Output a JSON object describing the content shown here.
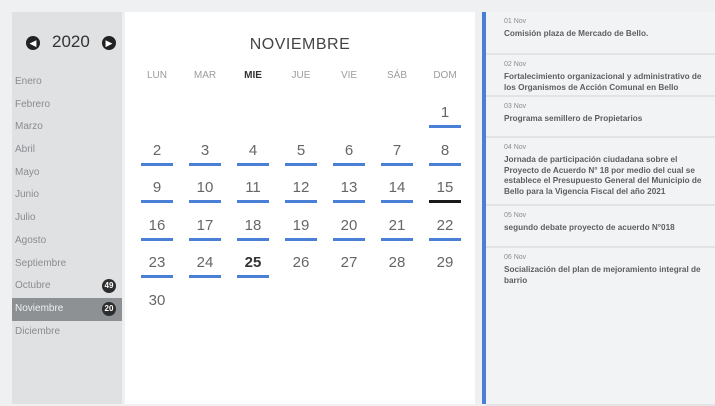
{
  "sidebar": {
    "year": "2020",
    "prev_icon": "chevron-left-icon",
    "next_icon": "chevron-right-icon",
    "months": [
      {
        "label": "Enero",
        "badge": ""
      },
      {
        "label": "Febrero",
        "badge": ""
      },
      {
        "label": "Marzo",
        "badge": ""
      },
      {
        "label": "Abril",
        "badge": ""
      },
      {
        "label": "Mayo",
        "badge": ""
      },
      {
        "label": "Junio",
        "badge": ""
      },
      {
        "label": "Julio",
        "badge": ""
      },
      {
        "label": "Agosto",
        "badge": ""
      },
      {
        "label": "Septiembre",
        "badge": ""
      },
      {
        "label": "Octubre",
        "badge": "49"
      },
      {
        "label": "Noviembre",
        "badge": "20"
      },
      {
        "label": "Diciembre",
        "badge": ""
      }
    ],
    "active_month": "Noviembre"
  },
  "calendar": {
    "title": "NOVIEMBRE",
    "weekdays": [
      "LUN",
      "MAR",
      "MIE",
      "JUE",
      "VIE",
      "SÁB",
      "DOM"
    ],
    "bold_weekday": "MIE",
    "days": [
      {
        "n": "1",
        "bar": "blue"
      },
      {
        "n": "2",
        "bar": "blue"
      },
      {
        "n": "3",
        "bar": "blue"
      },
      {
        "n": "4",
        "bar": "blue"
      },
      {
        "n": "5",
        "bar": "blue"
      },
      {
        "n": "6",
        "bar": "blue"
      },
      {
        "n": "7",
        "bar": "blue"
      },
      {
        "n": "8",
        "bar": "blue"
      },
      {
        "n": "9",
        "bar": "blue"
      },
      {
        "n": "10",
        "bar": "blue"
      },
      {
        "n": "11",
        "bar": "blue"
      },
      {
        "n": "12",
        "bar": "blue"
      },
      {
        "n": "13",
        "bar": "blue"
      },
      {
        "n": "14",
        "bar": "blue"
      },
      {
        "n": "15",
        "bar": "dark"
      },
      {
        "n": "16",
        "bar": "blue"
      },
      {
        "n": "17",
        "bar": "blue"
      },
      {
        "n": "18",
        "bar": "blue"
      },
      {
        "n": "19",
        "bar": "blue"
      },
      {
        "n": "20",
        "bar": "blue"
      },
      {
        "n": "21",
        "bar": "blue"
      },
      {
        "n": "22",
        "bar": "blue"
      },
      {
        "n": "23",
        "bar": "blue"
      },
      {
        "n": "24",
        "bar": "blue"
      },
      {
        "n": "25",
        "bar": "blue",
        "bold": true
      },
      {
        "n": "26",
        "bar": ""
      },
      {
        "n": "27",
        "bar": ""
      },
      {
        "n": "28",
        "bar": ""
      },
      {
        "n": "29",
        "bar": ""
      },
      {
        "n": "30",
        "bar": ""
      }
    ],
    "first_weekday_index": 6
  },
  "events": [
    {
      "date": "01 Nov",
      "title": "Comisión plaza de Mercado de Bello."
    },
    {
      "date": "02 Nov",
      "title": "Fortalecimiento organizacional y administrativo de los Organismos de Acción Comunal en Bello"
    },
    {
      "date": "03 Nov",
      "title": "Programa semillero de Propietarios"
    },
    {
      "date": "04 Nov",
      "title": "Jornada de participación ciudadana sobre el Proyecto de Acuerdo N° 18 por medio del cual se establece el Presupuesto General del Municipio de Bello para la Vigencia Fiscal del año 2021"
    },
    {
      "date": "05 Nov",
      "title": "segundo debate proyecto de acuerdo N°018"
    },
    {
      "date": "06 Nov",
      "title": "Socialización del plan de mejoramiento integral de barrio"
    }
  ],
  "colors": {
    "accent": "#4a7fd6",
    "active_month_bg": "#8e9194"
  }
}
